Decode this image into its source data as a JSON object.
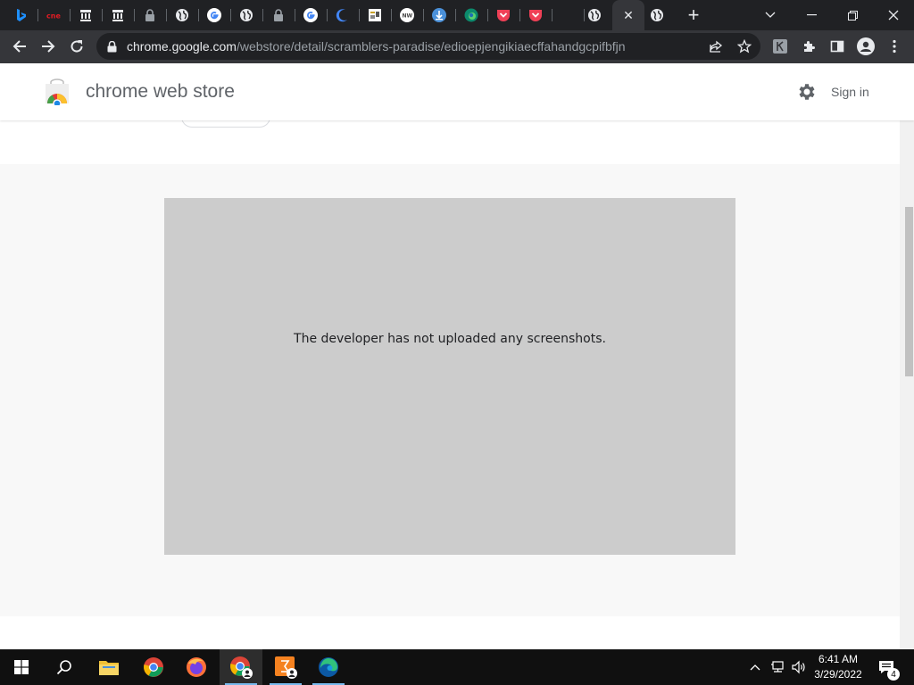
{
  "browser": {
    "tabs": [
      {
        "icon": "bing-icon",
        "color": "#1e90ff",
        "glyph": "b"
      },
      {
        "icon": "cnet-icon",
        "color": "#e31b23",
        "glyph": "cnet"
      },
      {
        "icon": "archive-icon",
        "color": "#e8eaed",
        "glyph": ""
      },
      {
        "icon": "archive-icon",
        "color": "#e8eaed",
        "glyph": ""
      },
      {
        "icon": "lock-icon",
        "color": "#9aa0a6",
        "glyph": ""
      },
      {
        "icon": "globe-icon",
        "color": "#e8eaed",
        "glyph": ""
      },
      {
        "icon": "google-icon",
        "color": "#4285f4",
        "glyph": "G"
      },
      {
        "icon": "globe-icon",
        "color": "#e8eaed",
        "glyph": ""
      },
      {
        "icon": "lock-icon",
        "color": "#9aa0a6",
        "glyph": ""
      },
      {
        "icon": "google-icon",
        "color": "#4285f4",
        "glyph": "G"
      },
      {
        "icon": "crescent-icon",
        "color": "#4285f4",
        "glyph": ""
      },
      {
        "icon": "site-icon",
        "color": "#ffffff",
        "glyph": ""
      },
      {
        "icon": "newsweek-icon",
        "color": "#ffffff",
        "glyph": "NW"
      },
      {
        "icon": "download-icon",
        "color": "#4a90d9",
        "glyph": ""
      },
      {
        "icon": "edge-icon",
        "color": "#2fb171",
        "glyph": ""
      },
      {
        "icon": "pocket-icon",
        "color": "#ef4056",
        "glyph": ""
      },
      {
        "icon": "pocket-icon",
        "color": "#ef4056",
        "glyph": ""
      },
      {
        "icon": "blank-icon",
        "color": "#202124",
        "glyph": ""
      },
      {
        "icon": "globe-icon",
        "color": "#e8eaed",
        "glyph": ""
      },
      {
        "icon": "close-icon",
        "color": "#e8eaed",
        "glyph": "✕"
      },
      {
        "icon": "globe-icon",
        "color": "#e8eaed",
        "glyph": ""
      }
    ],
    "url_host": "chrome.google.com",
    "url_path": "/webstore/detail/scramblers-paradise/edioepjengikiaecffahandgcpifbfjn",
    "new_tab_glyph": "+"
  },
  "store": {
    "title": "chrome web store",
    "signin_label": "Sign in",
    "no_screenshots_text": "The developer has not uploaded any screenshots."
  },
  "taskbar": {
    "apps": [
      "start-icon",
      "search-icon",
      "file-explorer-icon",
      "chrome-icon",
      "firefox-icon",
      "chrome-profile-icon",
      "app-profile-icon",
      "edge-icon"
    ],
    "time": "6:41 AM",
    "date": "3/29/2022",
    "notification_count": "4"
  },
  "colors": {
    "tabstrip": "#202124",
    "toolbar": "#35363a",
    "placeholder": "#cccccc",
    "band": "#f8f8f8",
    "taskbar": "#101010"
  }
}
